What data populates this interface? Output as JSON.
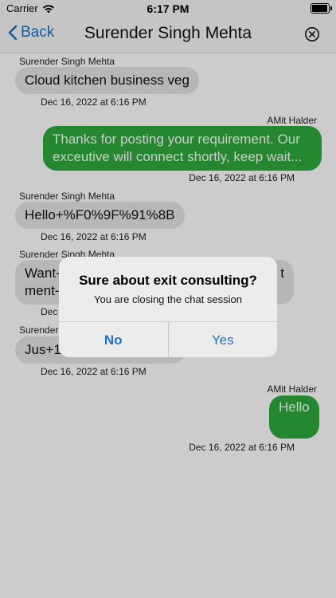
{
  "status": {
    "carrier": "Carrier",
    "time": "6:17 PM"
  },
  "nav": {
    "back_label": "Back",
    "title": "Surender Singh Mehta"
  },
  "messages": [
    {
      "sender": "Surender Singh Mehta",
      "text": "Cloud kitchen business veg",
      "time": "Dec 16, 2022 at 6:16 PM"
    },
    {
      "sender": "AMit Halder",
      "text": "Thanks for posting your requirement. Our exceutive will connect shortly, keep wait...",
      "time": "Dec 16, 2022 at 6:16 PM"
    },
    {
      "sender": "Surender Singh Mehta",
      "text": "Hello+%F0%9F%91%8B",
      "time": "Dec 16, 2022 at 6:16 PM"
    },
    {
      "sender": "Surender Singh Mehta",
      "text_line1": "Want-",
      "text_line1_end": "t",
      "text_line2": "ment-",
      "time_partial": "Dec"
    },
    {
      "sender_partial": "Surender",
      "text": "Jus+1",
      "time": "Dec 16, 2022 at 6:16 PM"
    },
    {
      "sender": "AMit Halder",
      "text": "Hello",
      "time": "Dec 16, 2022 at 6:16 PM"
    }
  ],
  "alert": {
    "title": "Sure about exit consulting?",
    "message": "You are closing the chat session",
    "no_label": "No",
    "yes_label": "Yes"
  },
  "colors": {
    "accent": "#1b72c9",
    "outgoing_bubble": "#2faa3e",
    "incoming_bubble": "#e5e5e5"
  }
}
